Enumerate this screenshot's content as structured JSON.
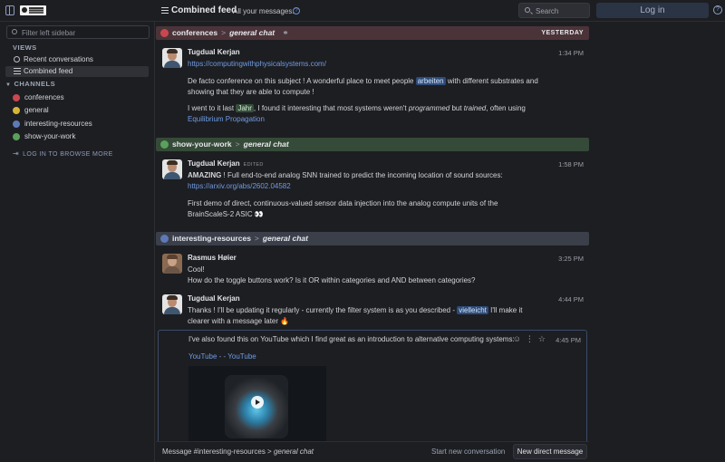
{
  "topbar": {
    "title": "Combined feed",
    "subtitle": "All your messages.",
    "search_label": "Search",
    "login_label": "Log in"
  },
  "sidebar": {
    "filter_placeholder": "Filter left sidebar",
    "views_heading": "VIEWS",
    "views": [
      {
        "label": "Recent conversations",
        "icon": "clock-icon"
      },
      {
        "label": "Combined feed",
        "icon": "feed-icon"
      }
    ],
    "channels_heading": "CHANNELS",
    "channels": [
      {
        "label": "conferences",
        "color": "#c9484f"
      },
      {
        "label": "general",
        "color": "#d6b43a"
      },
      {
        "label": "interesting-resources",
        "color": "#5f79b5"
      },
      {
        "label": "show-your-work",
        "color": "#5aa05a"
      }
    ],
    "browse_label": "LOG IN TO BROWSE MORE"
  },
  "feed": {
    "groups": [
      {
        "stream": "conferences",
        "topic": "general chat",
        "date": "YESTERDAY",
        "bg": "#4b3439",
        "icon_color": "#c9484f",
        "messages": [
          {
            "sender": "Tugdual Kerjan",
            "time": "1:34 PM",
            "link": "https://computingwithphysicalsystems.com/",
            "p1a": "De facto conference on this subject ! A wonderful place to meet people ",
            "p1hl": "arbeiten",
            "p1b": " with different substrates and showing that they are able to compute !",
            "p2a": "I went to it last ",
            "p2hl": "Jahr",
            "p2b": ", I found it interesting that most systems weren't ",
            "p2i1": "programmed",
            "p2c": " but ",
            "p2i2": "trained",
            "p2d": ", often using ",
            "p2link": "Equilibrium Propagation"
          }
        ]
      },
      {
        "stream": "show-your-work",
        "topic": "general chat",
        "bg": "#354a38",
        "icon_color": "#5aa05a",
        "messages": [
          {
            "sender": "Tugdual Kerjan",
            "edited": "EDITED",
            "time": "1:58 PM",
            "p1strong": "AMAZING",
            "p1a": " ! Full end-to-end analog SNN trained to predict the incoming location of sound sources: ",
            "p1link": "https://arxiv.org/abs/2602.04582",
            "p2": "First demo of direct, continuous-valued sensor data injection into the analog compute units of the BrainScaleS-2 ASIC 👀"
          }
        ]
      },
      {
        "stream": "interesting-resources",
        "topic": "general chat",
        "bg": "#3a3f4a",
        "icon_color": "#5f79b5",
        "messages": [
          {
            "sender": "Rasmus Høier",
            "time": "3:25 PM",
            "l1": "Cool!",
            "l2": "How do the toggle buttons work? Is it OR within categories and AND between categories?"
          },
          {
            "sender": "Tugdual Kerjan",
            "time": "4:44 PM",
            "p1a": "Thanks ! I'll be updating it regularly - currently the filter system is as you described - ",
            "p1hl": "vielleicht",
            "p1b": " I'll make it clearer with a message later 🔥"
          },
          {
            "time": "4:45 PM",
            "text": "I've also found this on YouTube which I find great as an introduction to alternative computing systems:",
            "link": "YouTube - - YouTube"
          }
        ]
      }
    ]
  },
  "compose": {
    "prefix": "Message #interesting-resources > ",
    "topic": "general chat",
    "start_new": "Start new conversation",
    "new_dm": "New direct message"
  }
}
